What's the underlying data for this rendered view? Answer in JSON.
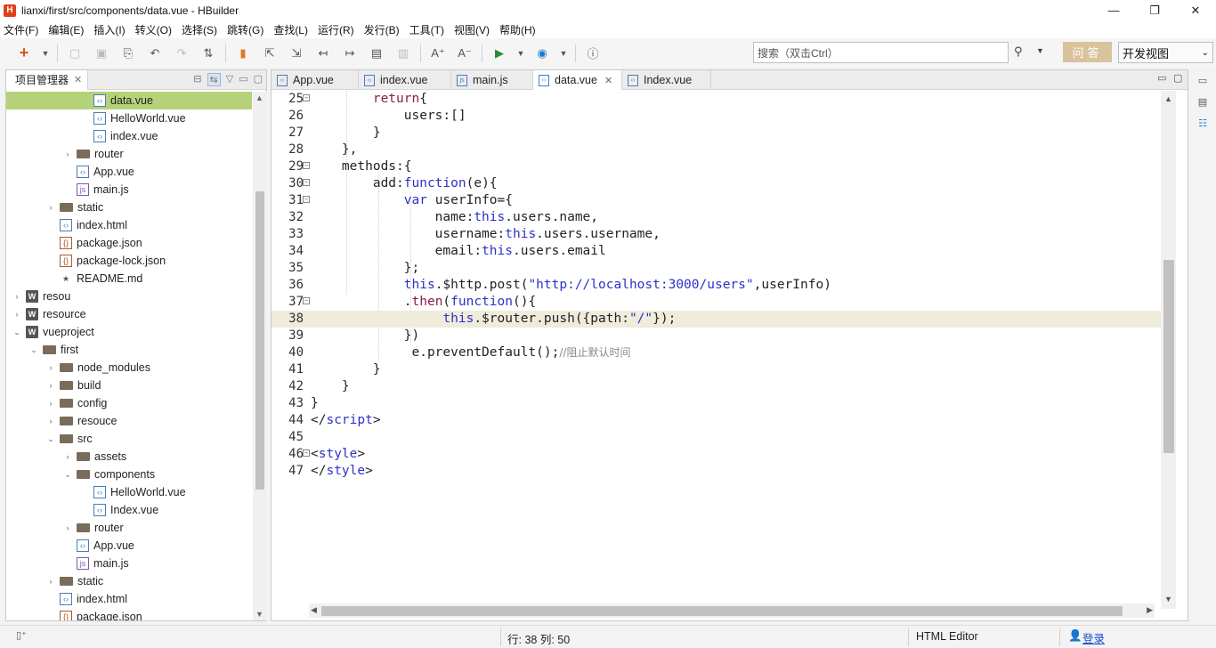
{
  "window": {
    "logo": "H",
    "title": "lianxi/first/src/components/data.vue  -  HBuilder",
    "minimize": "—",
    "maximize": "❐",
    "close": "✕"
  },
  "menu": [
    "文件(F)",
    "编辑(E)",
    "插入(I)",
    "转义(O)",
    "选择(S)",
    "跳转(G)",
    "查找(L)",
    "运行(R)",
    "发行(B)",
    "工具(T)",
    "视图(V)",
    "帮助(H)"
  ],
  "toolbar": {
    "search_placeholder": "搜索（双击Ctrl）",
    "ask_label": "问答",
    "view_label": "开发视图"
  },
  "project_panel": {
    "title": "项目管理器",
    "tree": [
      {
        "label": "data.vue",
        "icon": "vue",
        "depth": 5,
        "arrow": "",
        "selected": true
      },
      {
        "label": "HelloWorld.vue",
        "icon": "vue",
        "depth": 5,
        "arrow": ""
      },
      {
        "label": "index.vue",
        "icon": "vue",
        "depth": 5,
        "arrow": ""
      },
      {
        "label": "router",
        "icon": "folder",
        "depth": 4,
        "arrow": "›"
      },
      {
        "label": "App.vue",
        "icon": "vue",
        "depth": 4,
        "arrow": ""
      },
      {
        "label": "main.js",
        "icon": "js",
        "depth": 4,
        "arrow": ""
      },
      {
        "label": "static",
        "icon": "folder",
        "depth": 3,
        "arrow": "›"
      },
      {
        "label": "index.html",
        "icon": "html",
        "depth": 3,
        "arrow": ""
      },
      {
        "label": "package.json",
        "icon": "json",
        "depth": 3,
        "arrow": ""
      },
      {
        "label": "package-lock.json",
        "icon": "json",
        "depth": 3,
        "arrow": ""
      },
      {
        "label": "README.md",
        "icon": "star",
        "depth": 3,
        "arrow": ""
      },
      {
        "label": "resou",
        "icon": "project",
        "depth": 1,
        "arrow": "›"
      },
      {
        "label": "resource",
        "icon": "project",
        "depth": 1,
        "arrow": "›"
      },
      {
        "label": "vueproject",
        "icon": "project",
        "depth": 1,
        "arrow": "⌄"
      },
      {
        "label": "first",
        "icon": "folder",
        "depth": 2,
        "arrow": "⌄"
      },
      {
        "label": "node_modules",
        "icon": "folder",
        "depth": 3,
        "arrow": "›"
      },
      {
        "label": "build",
        "icon": "folder",
        "depth": 3,
        "arrow": "›"
      },
      {
        "label": "config",
        "icon": "folder",
        "depth": 3,
        "arrow": "›"
      },
      {
        "label": "resouce",
        "icon": "folder",
        "depth": 3,
        "arrow": "›"
      },
      {
        "label": "src",
        "icon": "folder",
        "depth": 3,
        "arrow": "⌄"
      },
      {
        "label": "assets",
        "icon": "folder",
        "depth": 4,
        "arrow": "›"
      },
      {
        "label": "components",
        "icon": "folder",
        "depth": 4,
        "arrow": "⌄"
      },
      {
        "label": "HelloWorld.vue",
        "icon": "vue",
        "depth": 5,
        "arrow": ""
      },
      {
        "label": "Index.vue",
        "icon": "vue",
        "depth": 5,
        "arrow": ""
      },
      {
        "label": "router",
        "icon": "folder",
        "depth": 4,
        "arrow": "›"
      },
      {
        "label": "App.vue",
        "icon": "vue",
        "depth": 4,
        "arrow": ""
      },
      {
        "label": "main.js",
        "icon": "js",
        "depth": 4,
        "arrow": ""
      },
      {
        "label": "static",
        "icon": "folder",
        "depth": 3,
        "arrow": "›"
      },
      {
        "label": "index.html",
        "icon": "html",
        "depth": 3,
        "arrow": ""
      },
      {
        "label": "package.json",
        "icon": "json",
        "depth": 3,
        "arrow": ""
      }
    ]
  },
  "editor": {
    "tabs": [
      {
        "label": "App.vue",
        "active": false
      },
      {
        "label": "index.vue",
        "active": false
      },
      {
        "label": "main.js",
        "active": false
      },
      {
        "label": "data.vue",
        "active": true
      },
      {
        "label": "Index.vue",
        "active": false
      }
    ],
    "current_line": 38,
    "lines": [
      {
        "n": "25",
        "fold": true,
        "html": "        <span class='kw'>return</span>{"
      },
      {
        "n": "26",
        "fold": false,
        "html": "            users:[]"
      },
      {
        "n": "27",
        "fold": false,
        "html": "        }"
      },
      {
        "n": "28",
        "fold": false,
        "html": "    },"
      },
      {
        "n": "29",
        "fold": true,
        "html": "    methods:{"
      },
      {
        "n": "30",
        "fold": true,
        "html": "        add:<span class='kb'>function</span>(e){"
      },
      {
        "n": "31",
        "fold": true,
        "html": "            <span class='kb'>var</span> userInfo={"
      },
      {
        "n": "32",
        "fold": false,
        "html": "                name:<span class='kb'>this</span>.users.name,"
      },
      {
        "n": "33",
        "fold": false,
        "html": "                username:<span class='kb'>this</span>.users.username,"
      },
      {
        "n": "34",
        "fold": false,
        "html": "                email:<span class='kb'>this</span>.users.email"
      },
      {
        "n": "35",
        "fold": false,
        "html": "            };"
      },
      {
        "n": "36",
        "fold": false,
        "html": "            <span class='kb'>this</span>.$http.post(<span class='str'>\"http://localhost:3000/users\"</span>,userInfo)"
      },
      {
        "n": "37",
        "fold": true,
        "html": "            .<span class='kw'>then</span>(<span class='kb'>function</span>(){"
      },
      {
        "n": "38",
        "fold": false,
        "html": "                 <span class='kb'>this</span>.$router.push({path:<span class='str'>\"/\"</span>});"
      },
      {
        "n": "39",
        "fold": false,
        "html": "            })"
      },
      {
        "n": "40",
        "fold": false,
        "html": "             e.preventDefault();<span class='cm'>//阻止默认时间</span>"
      },
      {
        "n": "41",
        "fold": false,
        "html": "        }"
      },
      {
        "n": "42",
        "fold": false,
        "html": "    }"
      },
      {
        "n": "43",
        "fold": false,
        "html": "}"
      },
      {
        "n": "44",
        "fold": false,
        "html": "&lt;/<span class='tag'>script</span>&gt;"
      },
      {
        "n": "45",
        "fold": false,
        "html": ""
      },
      {
        "n": "46",
        "fold": true,
        "html": "&lt;<span class='tag'>style</span>&gt;"
      },
      {
        "n": "47",
        "fold": false,
        "html": "&lt;/<span class='tag'>style</span>&gt;"
      }
    ]
  },
  "status": {
    "position": "行: 38 列: 50",
    "editor_type": "HTML Editor",
    "login": "登录"
  }
}
